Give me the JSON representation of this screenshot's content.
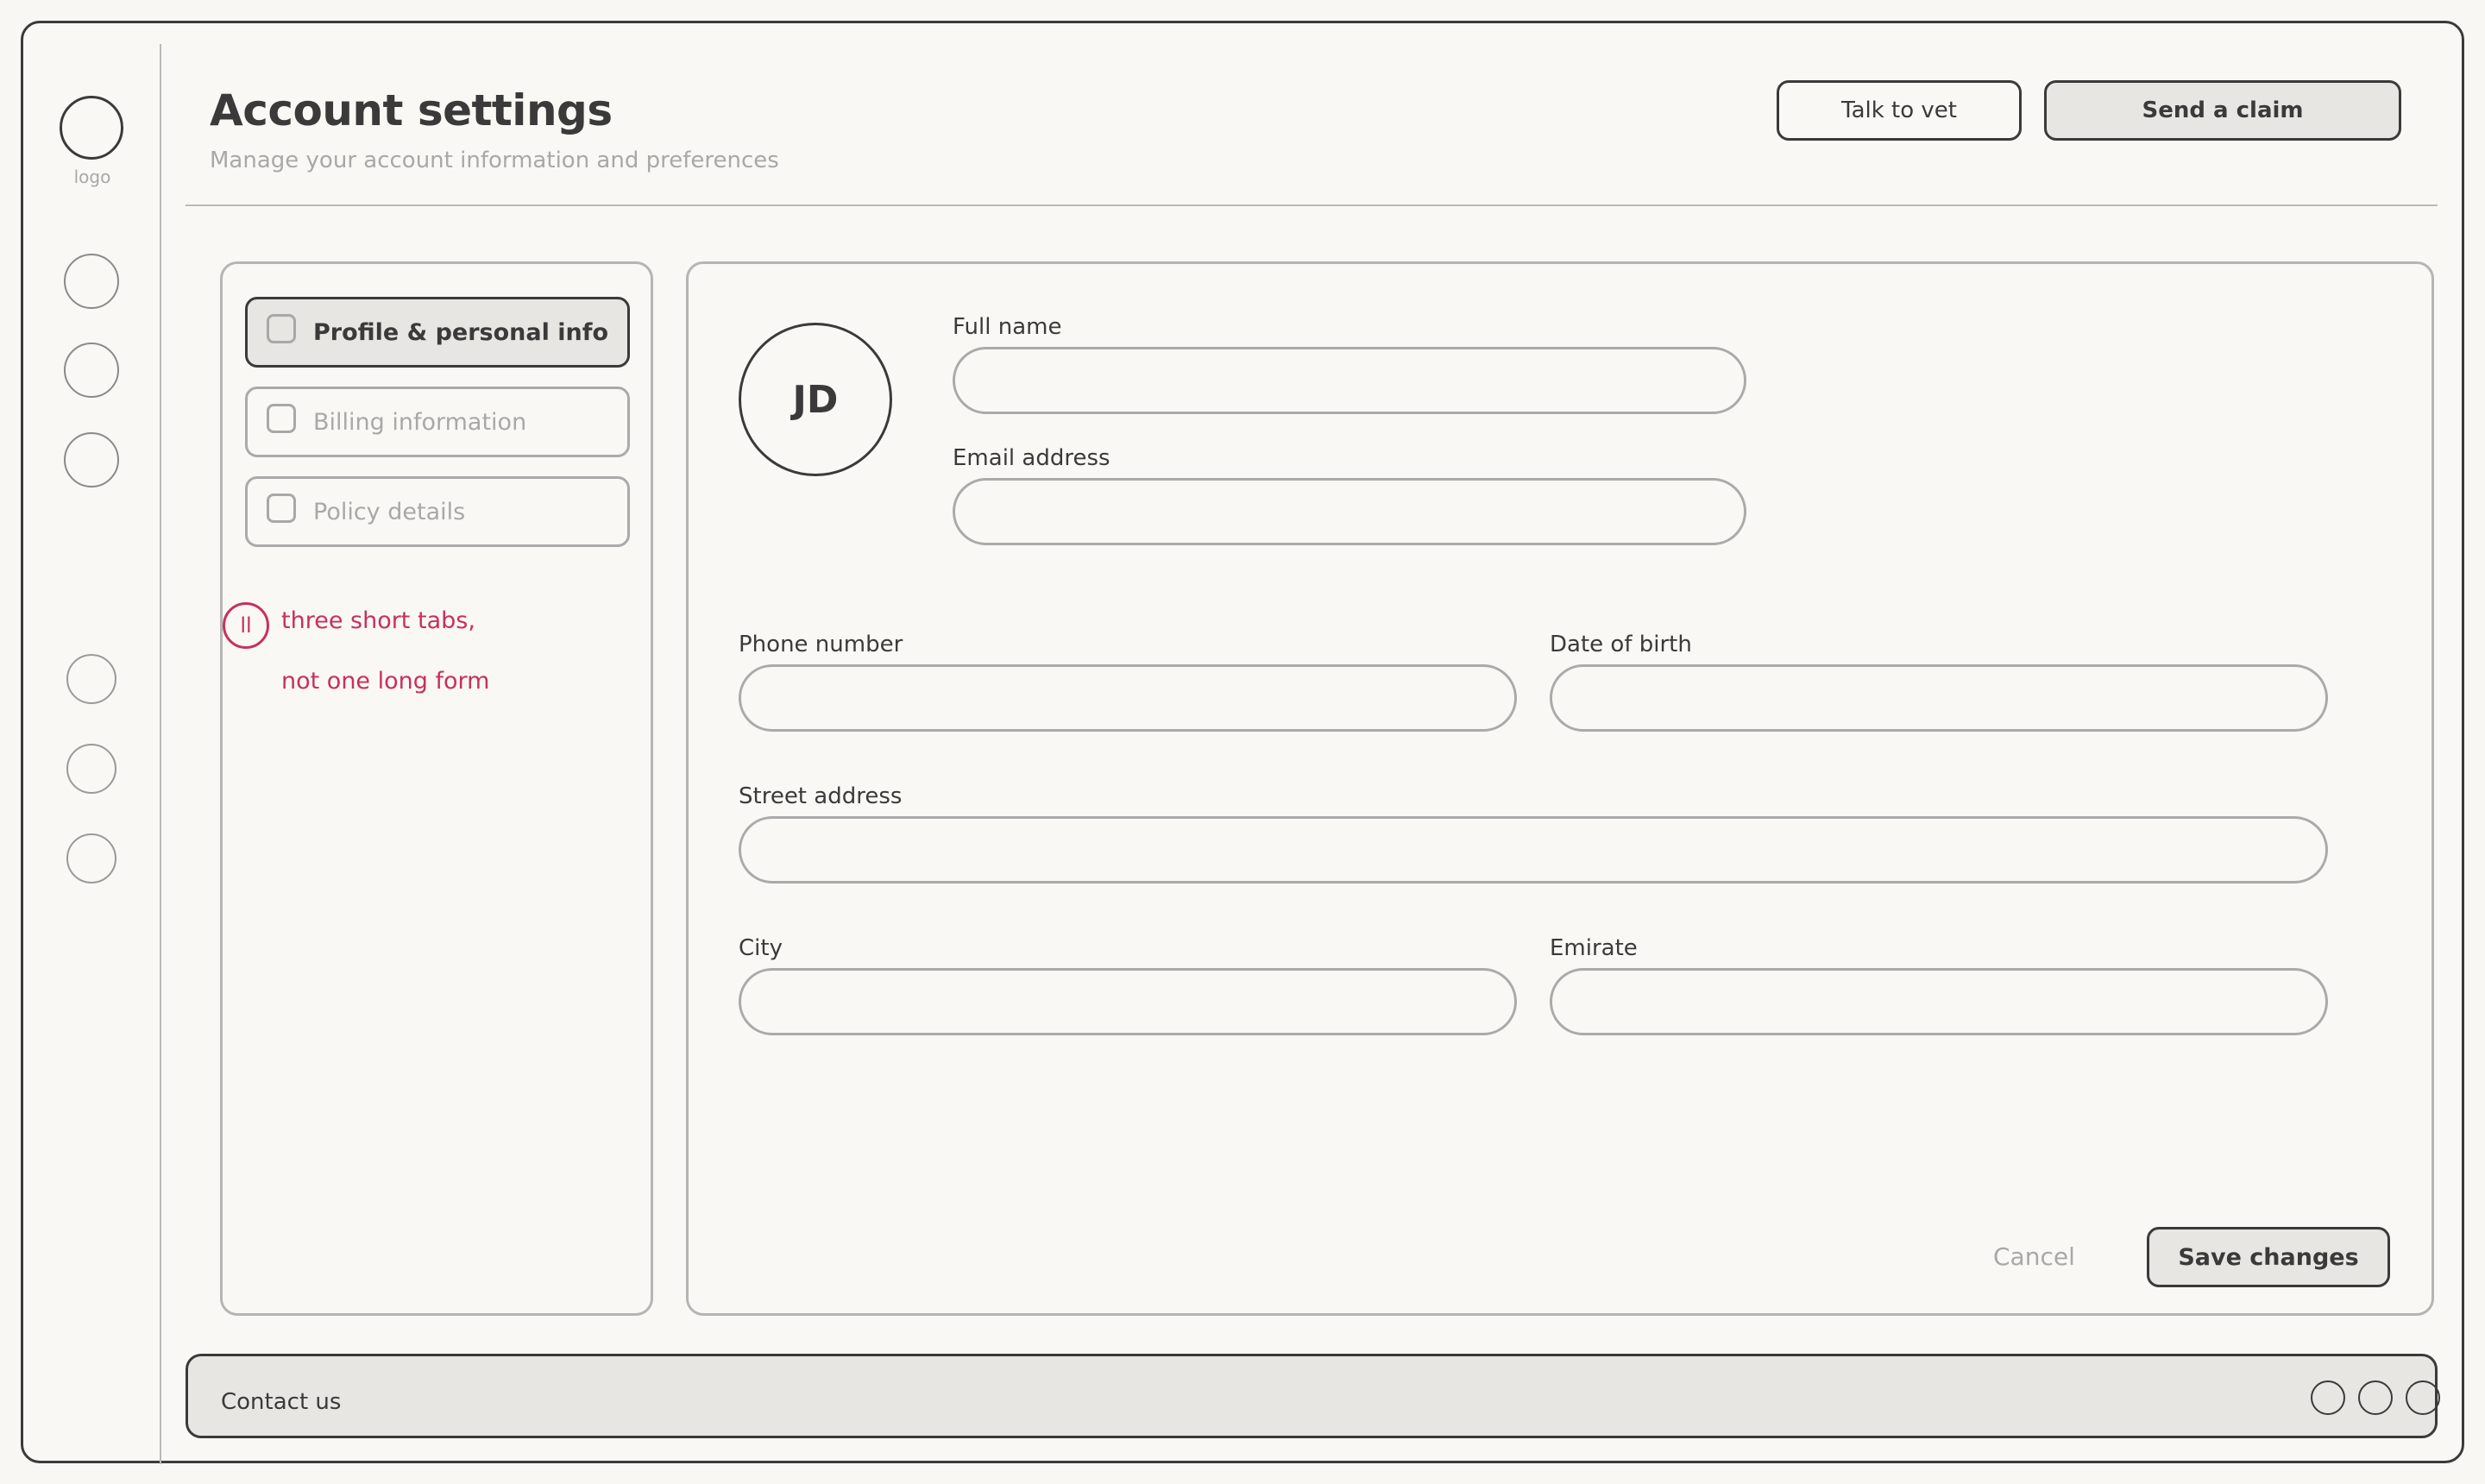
{
  "sidebar": {
    "logo_label": "logo",
    "icons": [
      "nav-icon-1",
      "nav-icon-2",
      "nav-icon-3",
      "nav-icon-4",
      "nav-icon-5",
      "nav-icon-6"
    ]
  },
  "header": {
    "title": "Account settings",
    "subtitle": "Manage your account information and preferences",
    "talk_to_vet_label": "Talk to vet",
    "send_claim_label": "Send a claim"
  },
  "tabs": [
    {
      "label": "Profile & personal info",
      "active": true
    },
    {
      "label": "Billing information",
      "active": false
    },
    {
      "label": "Policy details",
      "active": false
    }
  ],
  "annotation": {
    "marker": "ll",
    "line1": "three short tabs,",
    "line2": "not one long form",
    "color": "#c8305e"
  },
  "profile": {
    "avatar_initials": "JD"
  },
  "form": {
    "full_name": {
      "label": "Full name",
      "value": ""
    },
    "email": {
      "label": "Email address",
      "value": ""
    },
    "phone": {
      "label": "Phone number",
      "value": ""
    },
    "dob": {
      "label": "Date of birth",
      "value": ""
    },
    "street": {
      "label": "Street address",
      "value": ""
    },
    "city": {
      "label": "City",
      "value": ""
    },
    "emirate": {
      "label": "Emirate",
      "value": ""
    }
  },
  "actions": {
    "cancel_label": "Cancel",
    "save_label": "Save changes"
  },
  "footer": {
    "contact_label": "Contact us",
    "social_icons": [
      "social-icon-1",
      "social-icon-2",
      "social-icon-3"
    ]
  }
}
